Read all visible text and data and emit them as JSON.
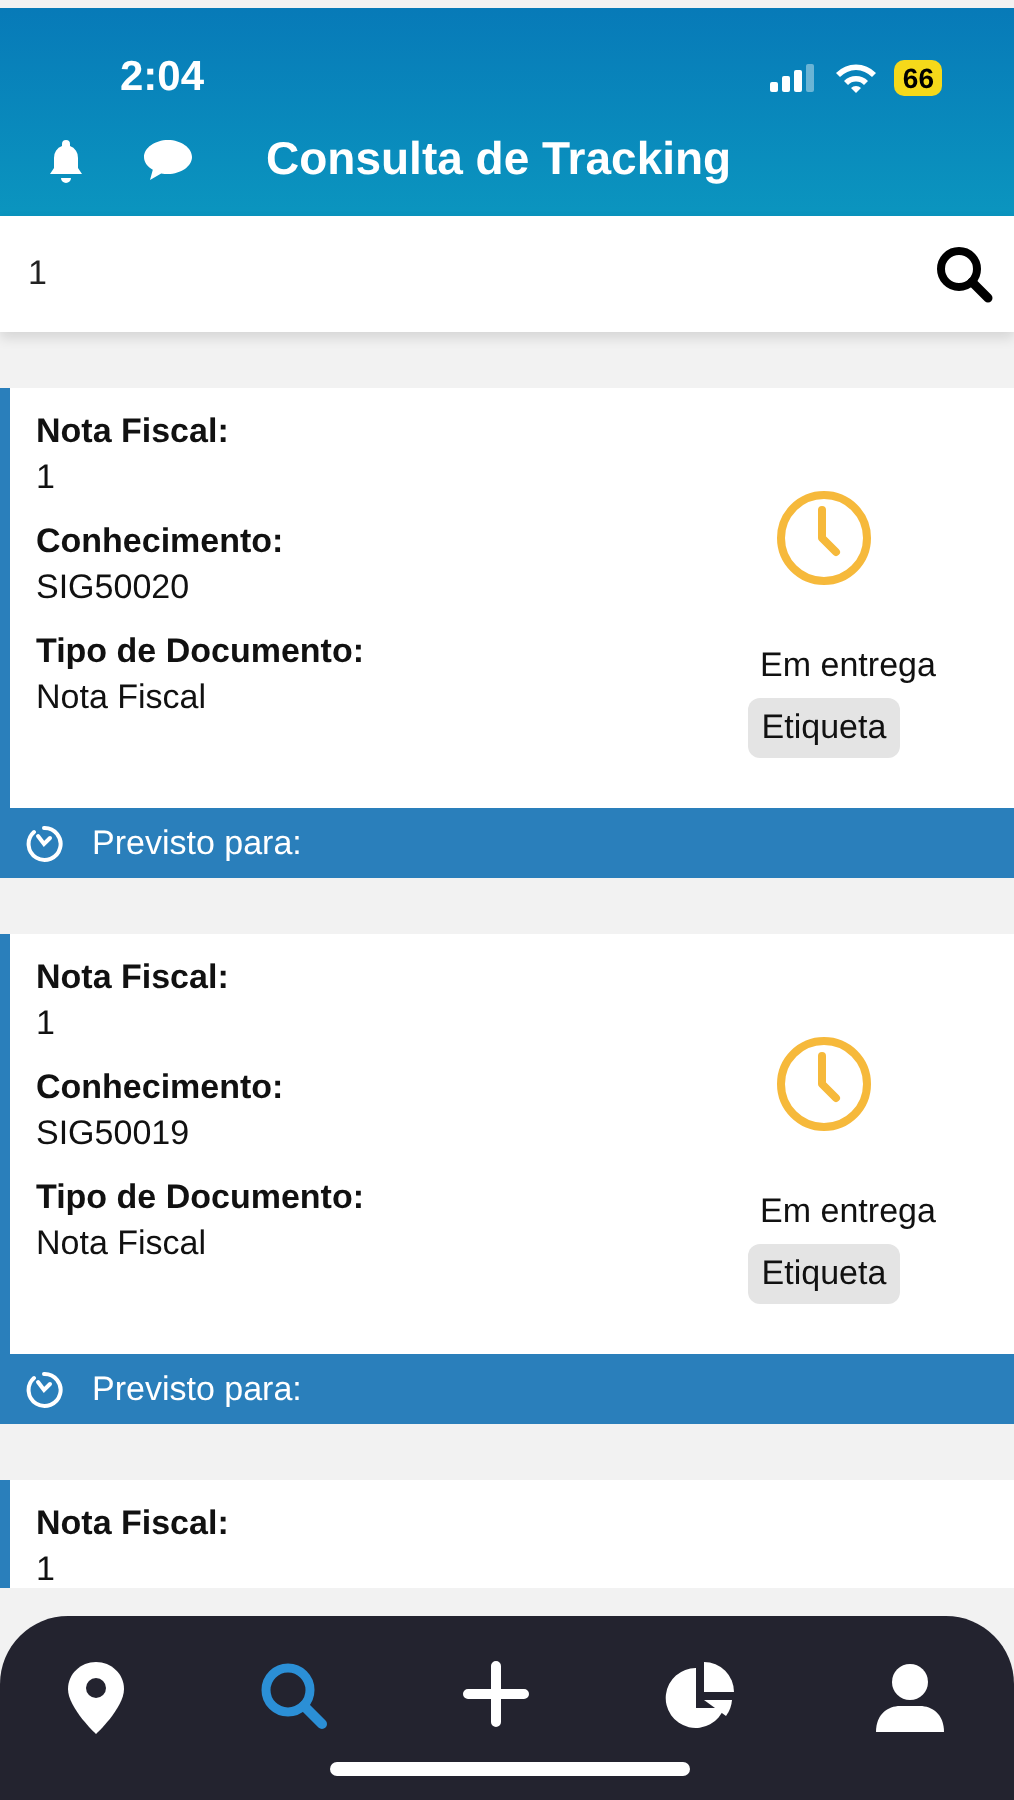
{
  "status_bar": {
    "time": "2:04",
    "battery": "66"
  },
  "header": {
    "title": "Consulta de Tracking"
  },
  "search": {
    "value": "1"
  },
  "cards": [
    {
      "fields": [
        {
          "label": "Nota Fiscal:",
          "value": "1"
        },
        {
          "label": "Conhecimento:",
          "value": "SIG50020"
        },
        {
          "label": "Tipo de Documento:",
          "value": "Nota Fiscal"
        }
      ],
      "status": "Em entrega",
      "action": "Etiqueta",
      "footer": "Previsto para:"
    },
    {
      "fields": [
        {
          "label": "Nota Fiscal:",
          "value": "1"
        },
        {
          "label": "Conhecimento:",
          "value": "SIG50019"
        },
        {
          "label": "Tipo de Documento:",
          "value": "Nota Fiscal"
        }
      ],
      "status": "Em entrega",
      "action": "Etiqueta",
      "footer": "Previsto para:"
    },
    {
      "fields": [
        {
          "label": "Nota Fiscal:",
          "value": "1"
        }
      ]
    }
  ],
  "nav": [
    {
      "kind": "map",
      "selected": false
    },
    {
      "kind": "search",
      "selected": true
    },
    {
      "kind": "add",
      "selected": false
    },
    {
      "kind": "chart",
      "selected": false
    },
    {
      "kind": "profile",
      "selected": false
    }
  ]
}
